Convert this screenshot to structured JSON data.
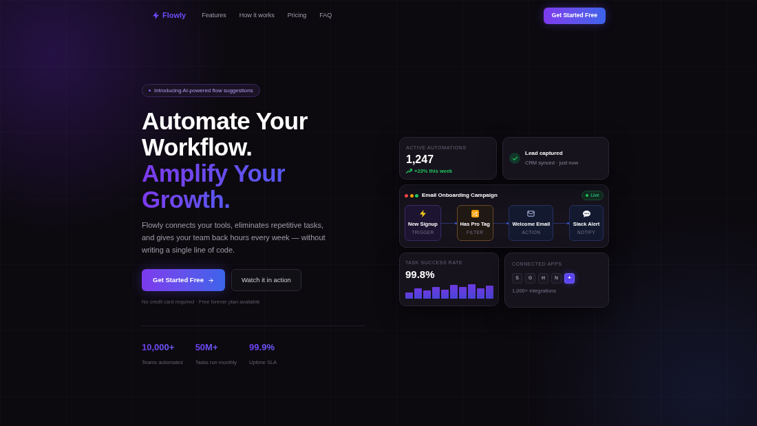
{
  "nav": {
    "brand": "Flowly",
    "links": [
      "Features",
      "How it works",
      "Pricing",
      "FAQ"
    ],
    "cta": "Get Started Free"
  },
  "hero": {
    "badge": "Introducing AI-powered flow suggestions",
    "heading": [
      {
        "text": "Automate Your",
        "kind": "plain"
      },
      {
        "text": "Workflow.",
        "kind": "plain"
      },
      {
        "text": "Amplify Your",
        "kind": "accent"
      },
      {
        "text": "Growth.",
        "kind": "accent"
      }
    ],
    "description": "Flowly connects your tools, eliminates repetitive tasks, and gives your team back hours every week — without writing a single line of code.",
    "primary_button": "Get Started Free",
    "secondary_button": "Watch it in action",
    "note": "No credit card required · Free forever plan available",
    "stats": [
      {
        "value": "10,000+",
        "label": "Teams automated"
      },
      {
        "value": "50M+",
        "label": "Tasks run monthly"
      },
      {
        "value": "99.9%",
        "label": "Uptime SLA"
      }
    ]
  },
  "dashboard": {
    "active_automations": {
      "label": "ACTIVE AUTOMATIONS",
      "value": "1,247",
      "trend": "+23% this week"
    },
    "notification": {
      "title": "Lead captured",
      "subtitle": "CRM synced · just now"
    },
    "workflow": {
      "dots": [
        {
          "color": "#ef4444"
        },
        {
          "color": "#f59e0b"
        },
        {
          "color": "#22c55e"
        }
      ],
      "title": "Email Onboarding Campaign",
      "status": "Live",
      "nodes": [
        {
          "label": "New Signup",
          "type_label": "TRIGGER",
          "kind": "trigger"
        },
        {
          "label": "Has Pro Tag",
          "type_label": "FILTER",
          "kind": "filter"
        },
        {
          "label": "Welcome Email",
          "type_label": "ACTION",
          "kind": "action"
        },
        {
          "label": "Slack Alert",
          "type_label": "NOTIFY",
          "kind": "notify"
        }
      ]
    },
    "success_rate": {
      "label": "TASK SUCCESS RATE",
      "value": "99.8%"
    },
    "connected_apps": {
      "label": "CONNECTED APPS",
      "apps": [
        {
          "label": "S",
          "kind": "app"
        },
        {
          "label": "G",
          "kind": "app"
        },
        {
          "label": "H",
          "kind": "app"
        },
        {
          "label": "N",
          "kind": "app"
        },
        {
          "label": "+",
          "kind": "add"
        }
      ],
      "caption": "1,000+ integrations"
    }
  }
}
